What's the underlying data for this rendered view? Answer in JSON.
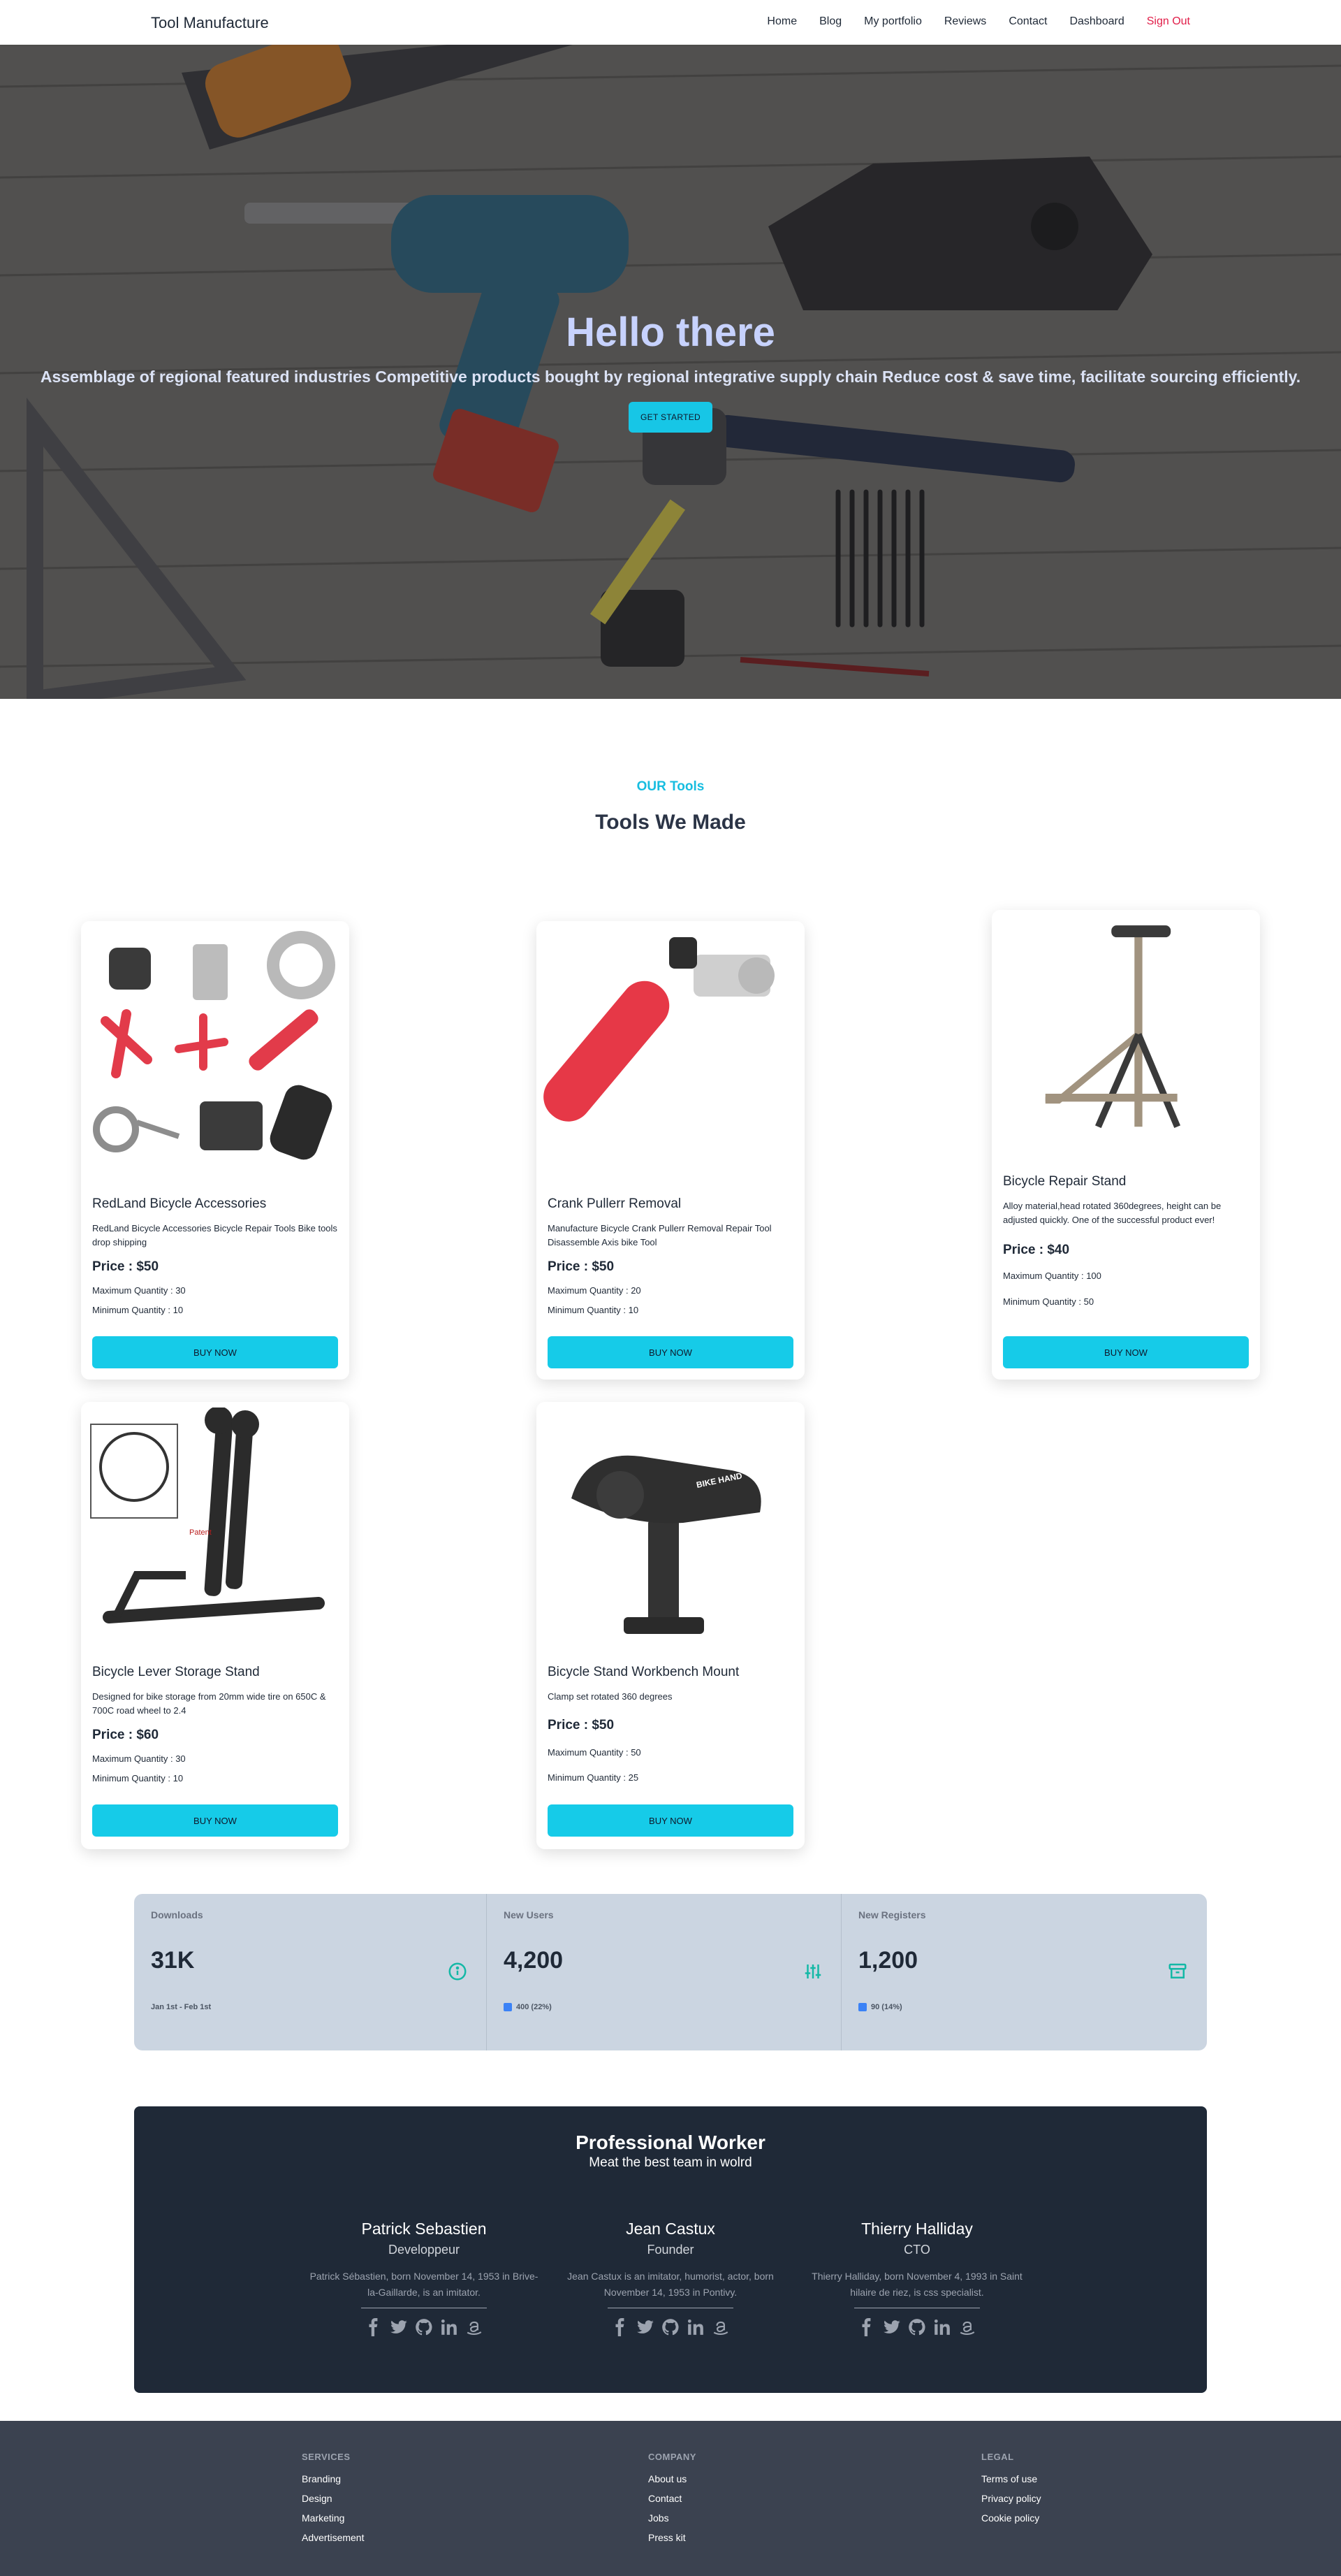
{
  "nav": {
    "brand": "Tool Manufacture",
    "links": [
      "Home",
      "Blog",
      "My portfolio",
      "Reviews",
      "Contact",
      "Dashboard",
      "Sign Out"
    ]
  },
  "hero": {
    "title": "Hello there",
    "subtitle": "Assemblage of regional featured industries Competitive products bought by regional integrative supply chain Reduce cost & save time, facilitate sourcing efficiently.",
    "cta": "GET STARTED",
    "background_icon": "tools-on-wooden-table-photo"
  },
  "tools_section": {
    "eyebrow": "OUR Tools",
    "title": "Tools We Made"
  },
  "products": [
    {
      "name": "RedLand Bicycle Accessories",
      "description": "RedLand Bicycle Accessories Bicycle Repair Tools Bike tools drop shipping",
      "price": "Price : $50",
      "max_qty": "Maximum Quantity : 30",
      "min_qty": "Minimum Quantity : 10",
      "button": "BUY NOW",
      "image_icon": "bicycle-tool-set-image"
    },
    {
      "name": "Crank Pullerr Removal",
      "description": "Manufacture Bicycle Crank Pullerr Removal Repair Tool Disassemble Axis bike Tool",
      "price": "Price : $50",
      "max_qty": "Maximum Quantity : 20",
      "min_qty": "Minimum Quantity : 10",
      "button": "BUY NOW",
      "image_icon": "crank-puller-image"
    },
    {
      "name": "Bicycle Repair Stand",
      "description": "Alloy material,head rotated 360degrees, height can be adjusted quickly. One of the successful product ever!",
      "price": "Price : $40",
      "max_qty": "Maximum Quantity : 100",
      "min_qty": "Minimum Quantity : 50",
      "button": "BUY NOW",
      "image_icon": "repair-stand-image"
    },
    {
      "name": "Bicycle Lever Storage Stand",
      "description": "Designed for bike storage from 20mm wide tire on 650C & 700C road wheel to 2.4",
      "price": "Price : $60",
      "max_qty": "Maximum Quantity : 30",
      "min_qty": "Minimum Quantity : 10",
      "button": "BUY NOW",
      "image_icon": "storage-stand-image",
      "image_caption": "Patent"
    },
    {
      "name": "Bicycle Stand Workbench Mount",
      "description": "Clamp set rotated 360 degrees",
      "price": "Price : $50",
      "max_qty": "Maximum Quantity : 50",
      "min_qty": "Minimum Quantity : 25",
      "button": "BUY NOW",
      "image_icon": "workbench-mount-image",
      "image_caption": "BIKE HAND"
    }
  ],
  "stats": [
    {
      "label": "Downloads",
      "value": "31K",
      "foot": "Jan 1st - Feb 1st",
      "icon": "info-circle-icon",
      "icon_color": "#14b8a6"
    },
    {
      "label": "New Users",
      "value": "4,200",
      "foot": "400 (22%)",
      "icon": "sliders-icon",
      "icon_color": "#14b8a6"
    },
    {
      "label": "New Registers",
      "value": "1,200",
      "foot": "90 (14%)",
      "icon": "archive-icon",
      "icon_color": "#14b8a6"
    }
  ],
  "team": {
    "title": "Professional Worker",
    "subtitle": "Meat the best team in wolrd",
    "members": [
      {
        "name": "Patrick Sebastien",
        "role": "Developpeur",
        "bio": "Patrick Sébastien, born November 14, 1953 in Brive-la-Gaillarde, is an imitator."
      },
      {
        "name": "Jean Castux",
        "role": "Founder",
        "bio": "Jean Castux is an imitator, humorist, actor, born November 14, 1953 in Pontivy."
      },
      {
        "name": "Thierry Halliday",
        "role": "CTO",
        "bio": "Thierry Halliday, born November 4, 1993 in Saint hilaire de riez, is css specialist."
      }
    ],
    "social_icons": [
      "facebook-icon",
      "twitter-icon",
      "github-icon",
      "linkedin-icon",
      "amazon-icon"
    ]
  },
  "footer": {
    "services": {
      "title": "SERVICES",
      "links": [
        "Branding",
        "Design",
        "Marketing",
        "Advertisement"
      ]
    },
    "company": {
      "title": "COMPANY",
      "links": [
        "About us",
        "Contact",
        "Jobs",
        "Press kit"
      ]
    },
    "legal": {
      "title": "LEGAL",
      "links": [
        "Terms of use",
        "Privacy policy",
        "Cookie policy"
      ]
    }
  },
  "colors": {
    "accent": "#16cbe8",
    "hero_title": "#c7d2fe",
    "sign_out": "#e11d48",
    "stats_bg": "#cbd5e1",
    "team_bg": "#1f2937",
    "footer_bg": "#3b4250"
  }
}
